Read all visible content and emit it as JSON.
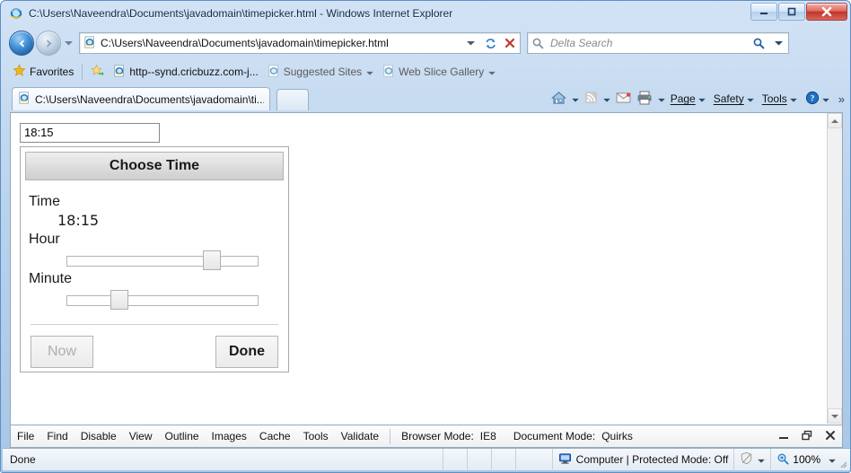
{
  "window": {
    "title": "C:\\Users\\Naveendra\\Documents\\javadomain\\timepicker.html - Windows Internet Explorer",
    "minimize_label": "Minimize",
    "restore_label": "Restore",
    "close_label": "Close"
  },
  "nav": {
    "back_label": "Back",
    "forward_label": "Forward",
    "history_label": "Recent Pages",
    "address_value": "C:\\Users\\Naveendra\\Documents\\javadomain\\timepicker.html",
    "address_dropdown_label": "Address dropdown",
    "refresh_label": "Refresh",
    "stop_label": "Stop",
    "search_placeholder": "Delta Search",
    "search_value": "",
    "search_dropdown_label": "Search provider"
  },
  "favorites_bar": {
    "favorites_label": "Favorites",
    "add_label": "Add to Favorites Bar",
    "items": [
      {
        "label": "http--synd.cricbuzz.com-j...",
        "dim": false,
        "caret": false
      },
      {
        "label": "Suggested Sites",
        "dim": true,
        "caret": true
      },
      {
        "label": "Web Slice Gallery",
        "dim": true,
        "caret": true
      }
    ]
  },
  "tabs": {
    "items": [
      {
        "label": "C:\\Users\\Naveendra\\Documents\\javadomain\\ti..."
      }
    ],
    "new_tab_label": "New Tab"
  },
  "command_bar": {
    "home_label": "Home",
    "feeds_label": "Feeds",
    "mail_label": "Read Mail",
    "print_label": "Print",
    "menus": [
      {
        "label": "Page",
        "accel": "P"
      },
      {
        "label": "Safety",
        "accel": "S"
      },
      {
        "label": "Tools",
        "accel": "o"
      },
      {
        "label": "Help",
        "accel": ""
      }
    ],
    "overflow_label": "»"
  },
  "page": {
    "time_input_value": "18:15",
    "scrollbar": {
      "up_label": "Scroll up",
      "down_label": "Scroll down"
    },
    "picker": {
      "header": "Choose Time",
      "time_label": "Time",
      "time_value": "18:15",
      "hour_label": "Hour",
      "hour_value": 18,
      "hour_min": 0,
      "hour_max": 23,
      "minute_label": "Minute",
      "minute_value": 15,
      "minute_min": 0,
      "minute_max": 59,
      "now_label": "Now",
      "now_disabled": true,
      "done_label": "Done",
      "done_disabled": false
    }
  },
  "dev_tools": {
    "menus": [
      {
        "label": "File",
        "accel": "F"
      },
      {
        "label": "Find",
        "accel": "n"
      },
      {
        "label": "Disable",
        "accel": "s"
      },
      {
        "label": "View",
        "accel": "V"
      },
      {
        "label": "Outline",
        "accel": "O"
      },
      {
        "label": "Images",
        "accel": "I"
      },
      {
        "label": "Cache",
        "accel": "C"
      },
      {
        "label": "Tools",
        "accel": "T"
      },
      {
        "label": "Validate",
        "accel": "a"
      }
    ],
    "browser_mode_label": "Browser Mode:",
    "browser_mode_value": "IE8",
    "document_mode_label": "Document Mode:",
    "document_mode_value": "Quirks",
    "minimize_label": "Minimize",
    "restore_label": "Restore",
    "close_label": "Close"
  },
  "status_bar": {
    "status_text": "Done",
    "zone_text": "Computer | Protected Mode: Off",
    "zone_dropdown_label": "Change zone",
    "zoom_value": "100%",
    "zoom_dropdown_label": "Change zoom level"
  },
  "colors": {
    "frame": "#a9c6e6",
    "accent_blue": "#14447f",
    "close_red": "#c0342a",
    "star_gold": "#f2b61b"
  }
}
